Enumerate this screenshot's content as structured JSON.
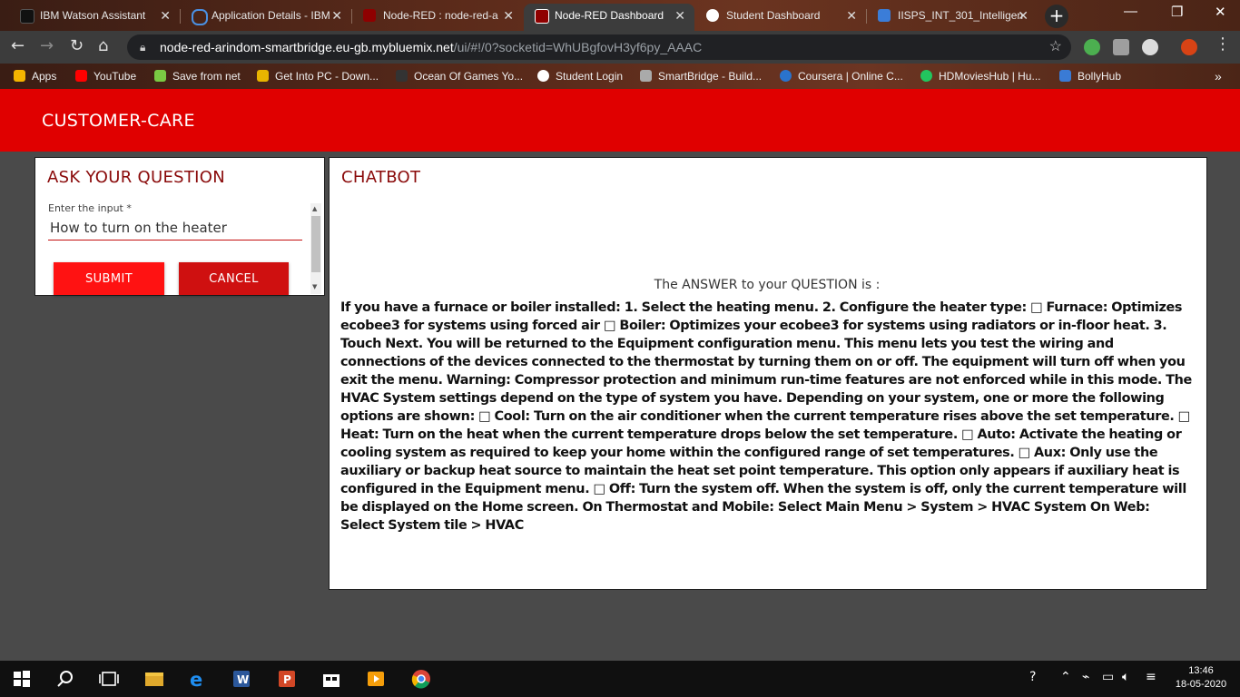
{
  "browser": {
    "tabs": [
      {
        "title": "IBM Watson Assistant",
        "icon": "ibm-watson-icon",
        "color": "#1a1a1a"
      },
      {
        "title": "Application Details - IBM",
        "icon": "ibm-cloud-icon",
        "color": "#1d6fc4"
      },
      {
        "title": "Node-RED : node-red-a",
        "icon": "node-red-icon",
        "color": "#8f0000"
      },
      {
        "title": "Node-RED Dashboard",
        "icon": "node-red-icon",
        "color": "#8f0000"
      },
      {
        "title": "Student Dashboard",
        "icon": "globe-icon",
        "color": "#ffffff"
      },
      {
        "title": "IISPS_INT_301_Intelligen",
        "icon": "document-icon",
        "color": "#3b7dd8"
      }
    ],
    "url_host": "node-red-arindom-smartbridge.eu-gb.mybluemix.net",
    "url_path": "/ui/#!/0?socketid=WhUBgfovH3yf6py_AAAC",
    "bookmarks": [
      {
        "label": "Apps",
        "icon": "apps-grid-icon",
        "color": "#f4b400"
      },
      {
        "label": "YouTube",
        "icon": "youtube-icon",
        "color": "#ff0000"
      },
      {
        "label": "Save from net",
        "icon": "download-arrow-icon",
        "color": "#7ac943"
      },
      {
        "label": "Get Into PC - Down...",
        "icon": "g-logo-icon",
        "color": "#e8b400"
      },
      {
        "label": "Ocean Of Games Yo...",
        "icon": "gamepad-icon",
        "color": "#333333"
      },
      {
        "label": "Student Login",
        "icon": "globe-icon",
        "color": "#ffffff"
      },
      {
        "label": "SmartBridge - Build...",
        "icon": "smartbridge-icon",
        "color": "#aaaaaa"
      },
      {
        "label": "Coursera | Online C...",
        "icon": "coursera-icon",
        "color": "#2a73cc"
      },
      {
        "label": "HDMoviesHub | Hu...",
        "icon": "hdmovies-icon",
        "color": "#22c55e"
      },
      {
        "label": "BollyHub",
        "icon": "bollyhub-icon",
        "color": "#3a7bd5"
      }
    ]
  },
  "app": {
    "title": "CUSTOMER-CARE",
    "header_color": "#e00000"
  },
  "ask_card": {
    "title": "ASK YOUR QUESTION",
    "input_label": "Enter the input *",
    "input_value": "How to turn on the heater",
    "submit_label": "SUBMIT",
    "cancel_label": "CANCEL"
  },
  "chatbot_card": {
    "title": "CHATBOT",
    "answer_header": "The ANSWER to your QUESTION is :",
    "answer_text": "If you have a furnace or boiler installed: 1. Select the heating menu. 2. Configure the heater type: □ Furnace: Optimizes ecobee3 for systems using forced air □ Boiler: Optimizes your ecobee3 for systems using radiators or in-floor heat. 3. Touch Next. You will be returned to the Equipment configuration menu. This menu lets you test the wiring and connections of the devices connected to the thermostat by turning them on or off. The equipment will turn off when you exit the menu. Warning: Compressor protection and minimum run-time features are not enforced while in this mode. The HVAC System settings depend on the type of system you have. Depending on your system, one or more the following options are shown: □ Cool: Turn on the air conditioner when the current temperature rises above the set temperature. □ Heat: Turn on the heat when the current temperature drops below the set temperature. □ Auto: Activate the heating or cooling system as required to keep your home within the configured range of set temperatures. □ Aux: Only use the auxiliary or backup heat source to maintain the heat set point temperature. This option only appears if auxiliary heat is configured in the Equipment menu. □ Off: Turn the system off. When the system is off, only the current temperature will be displayed on the Home screen. On Thermostat and Mobile: Select Main Menu > System > HVAC System On Web: Select System tile > HVAC"
  },
  "taskbar": {
    "time": "13:46",
    "date": "18-05-2020"
  }
}
